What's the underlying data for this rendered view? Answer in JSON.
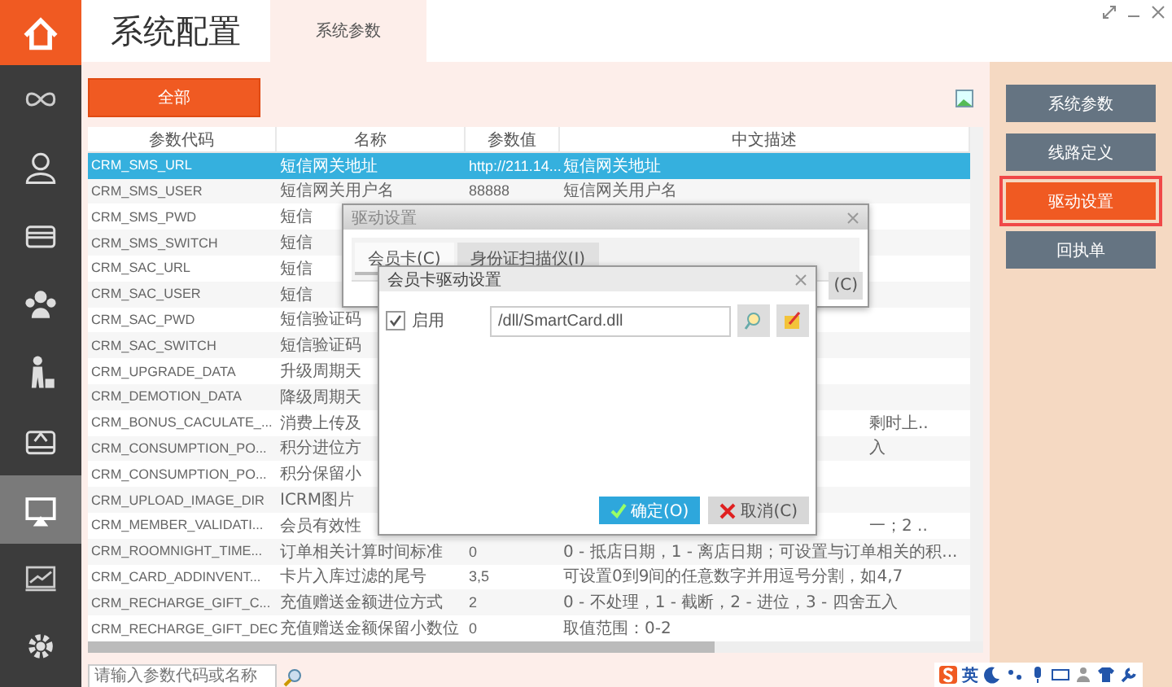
{
  "sidebar": {
    "items": [
      {
        "selected": false
      },
      {
        "selected": false
      },
      {
        "selected": false
      },
      {
        "selected": false
      },
      {
        "selected": false
      },
      {
        "selected": false
      },
      {
        "selected": true
      },
      {
        "selected": false
      },
      {
        "selected": false
      }
    ]
  },
  "header": {
    "title": "系统配置",
    "tabs": [
      {
        "label": "系统参数",
        "selected": true
      }
    ]
  },
  "toolbar": {
    "all_button": "全部"
  },
  "table": {
    "columns": [
      "参数代码",
      "名称",
      "参数值",
      "中文描述"
    ],
    "rows": [
      {
        "code": "CRM_SMS_URL",
        "name": "短信网关地址",
        "value": "http://211.14...",
        "description": "短信网关地址",
        "selected": true
      },
      {
        "code": "CRM_SMS_USER",
        "name": "短信网关用户名",
        "value": "88888",
        "description": "短信网关用户名",
        "selected": false
      },
      {
        "code": "CRM_SMS_PWD",
        "name": "短信",
        "selected": false
      },
      {
        "code": "CRM_SMS_SWITCH",
        "name": "短信",
        "selected": false
      },
      {
        "code": "CRM_SAC_URL",
        "name": "短信",
        "selected": false
      },
      {
        "code": "CRM_SAC_USER",
        "name": "短信",
        "selected": false
      },
      {
        "code": "CRM_SAC_PWD",
        "name": "短信验证码",
        "selected": false
      },
      {
        "code": "CRM_SAC_SWITCH",
        "name": "短信验证码",
        "selected": false
      },
      {
        "code": "CRM_UPGRADE_DATA",
        "name": "升级周期天",
        "selected": false
      },
      {
        "code": "CRM_DEMOTION_DATA",
        "name": "降级周期天",
        "selected": false
      },
      {
        "code": "CRM_BONUS_CACULATE_...",
        "name": "消费上传及",
        "description_tail": "剩时上..",
        "selected": false
      },
      {
        "code": "CRM_CONSUMPTION_PO...",
        "name": "积分进位方",
        "description_tail": "入",
        "selected": false
      },
      {
        "code": "CRM_CONSUMPTION_PO...",
        "name": "积分保留小",
        "selected": false
      },
      {
        "code": "CRM_UPLOAD_IMAGE_DIR",
        "name": "ICRM图片",
        "selected": false
      },
      {
        "code": "CRM_MEMBER_VALIDATI...",
        "name": "会员有效性",
        "description_tail": "一；2 ..",
        "selected": false
      },
      {
        "code": "CRM_ROOMNIGHT_TIME...",
        "name": "订单相关计算时间标准",
        "value": "0",
        "description": "0 - 抵店日期，1 - 离店日期；可设置与订单相关的积...",
        "selected": false
      },
      {
        "code": "CRM_CARD_ADDINVENT...",
        "name": "卡片入库过滤的尾号",
        "value": "3,5",
        "description": "可设置0到9间的任意数字并用逗号分割，如4,7",
        "selected": false
      },
      {
        "code": "CRM_RECHARGE_GIFT_C...",
        "name": "充值赠送金额进位方式",
        "value": "2",
        "description": "0 - 不处理，1 - 截断，2 - 进位，3 - 四舍五入",
        "selected": false
      },
      {
        "code": "CRM_RECHARGE_GIFT_DEC",
        "name": "充值赠送金额保留小数位",
        "value": "0",
        "description": "取值范围：0-2",
        "selected": false
      }
    ]
  },
  "search": {
    "placeholder": "请输入参数代码或名称"
  },
  "right_panel": {
    "buttons": [
      {
        "label": "系统参数",
        "selected": false
      },
      {
        "label": "线路定义",
        "selected": false
      },
      {
        "label": "驱动设置",
        "selected": true
      },
      {
        "label": "回执单",
        "selected": false
      }
    ]
  },
  "driver_dialog": {
    "title": "驱动设置",
    "tabs": [
      {
        "label": "会员卡(C)",
        "selected": true
      },
      {
        "label": "身份证扫描仪(I)",
        "selected": false
      }
    ],
    "partial_button": "(C)"
  },
  "card_dialog": {
    "title": "会员卡驱动设置",
    "enable": {
      "label": "启用",
      "checked": true
    },
    "path": "/dll/SmartCard.dll",
    "ok": "确定(O)",
    "cancel": "取消(C)"
  },
  "ime_toolbar": {
    "label": "英"
  }
}
